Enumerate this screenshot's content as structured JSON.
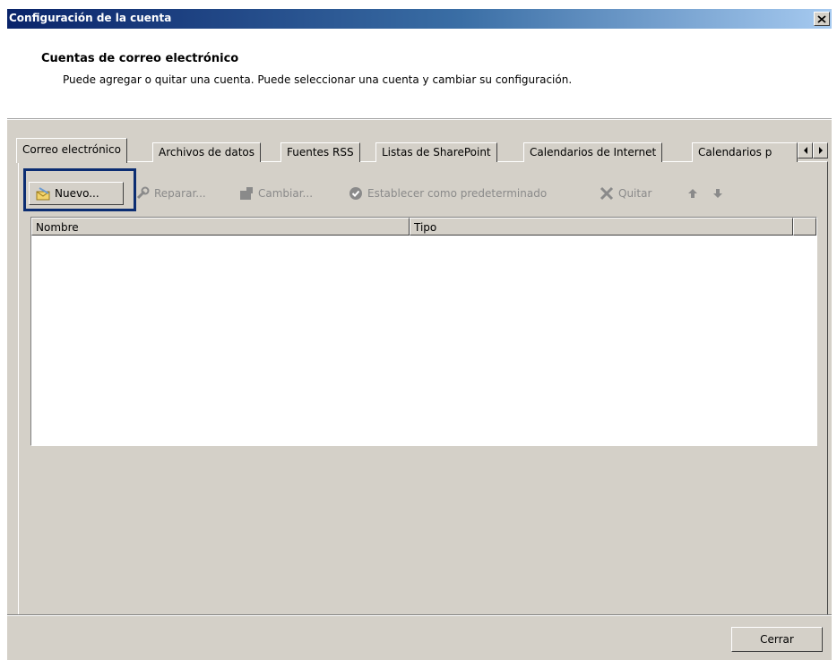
{
  "window": {
    "title": "Configuración de la cuenta",
    "close_glyph": "✕"
  },
  "header": {
    "heading": "Cuentas de correo electrónico",
    "description": "Puede agregar o quitar una cuenta. Puede seleccionar una cuenta y cambiar su configuración."
  },
  "tabs": [
    {
      "label": "Correo electrónico",
      "active": true
    },
    {
      "label": "Archivos de datos"
    },
    {
      "label": "Fuentes RSS"
    },
    {
      "label": "Listas de SharePoint"
    },
    {
      "label": "Calendarios de Internet"
    },
    {
      "label": "Calendarios p"
    }
  ],
  "toolbar": {
    "new_label": "Nuevo...",
    "repair_label": "Reparar...",
    "change_label": "Cambiar...",
    "default_label": "Establecer como predeterminado",
    "remove_label": "Quitar",
    "icons": [
      "new-mail-icon",
      "wrench-icon",
      "change-icon",
      "check-circle-icon",
      "x-icon",
      "arrow-up-icon",
      "arrow-down-icon"
    ]
  },
  "list": {
    "columns": [
      "Nombre",
      "Tipo"
    ],
    "rows": []
  },
  "footer": {
    "close_label": "Cerrar"
  },
  "colors": {
    "titlebar_start": "#0a246a",
    "titlebar_end": "#a6caf0",
    "dialog_face": "#d4d0c8",
    "highlight": "#0b2d72"
  }
}
